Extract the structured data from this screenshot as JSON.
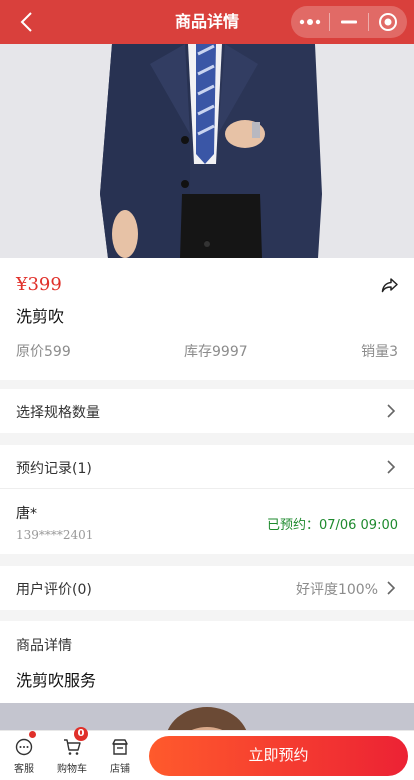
{
  "header": {
    "title": "商品详情"
  },
  "product": {
    "price": "¥399",
    "name": "洗剪吹",
    "original_price": "原价599",
    "stock": "库存9997",
    "sales": "销量3"
  },
  "spec": {
    "label": "选择规格数量"
  },
  "booking": {
    "header": "预约记录(1)",
    "items": [
      {
        "name": "唐*",
        "phone": "139****2401",
        "status": "已预约：07/06 09:00"
      }
    ]
  },
  "reviews": {
    "label": "用户评价(0)",
    "rating": "好评度100%"
  },
  "detail": {
    "title": "商品详情",
    "text": "洗剪吹服务"
  },
  "bottom_bar": {
    "service_label": "客服",
    "cart_label": "购物车",
    "cart_count": "0",
    "shop_label": "店铺",
    "book_button": "立即预约"
  },
  "colors": {
    "header": "#d9403c",
    "price": "#e0302a",
    "booked": "#1e8a2e"
  },
  "icons": [
    "back-arrow-icon",
    "more-dots-icon",
    "minimize-icon",
    "target-icon",
    "share-icon",
    "chevron-right-icon",
    "chat-icon",
    "cart-icon",
    "shop-icon"
  ]
}
